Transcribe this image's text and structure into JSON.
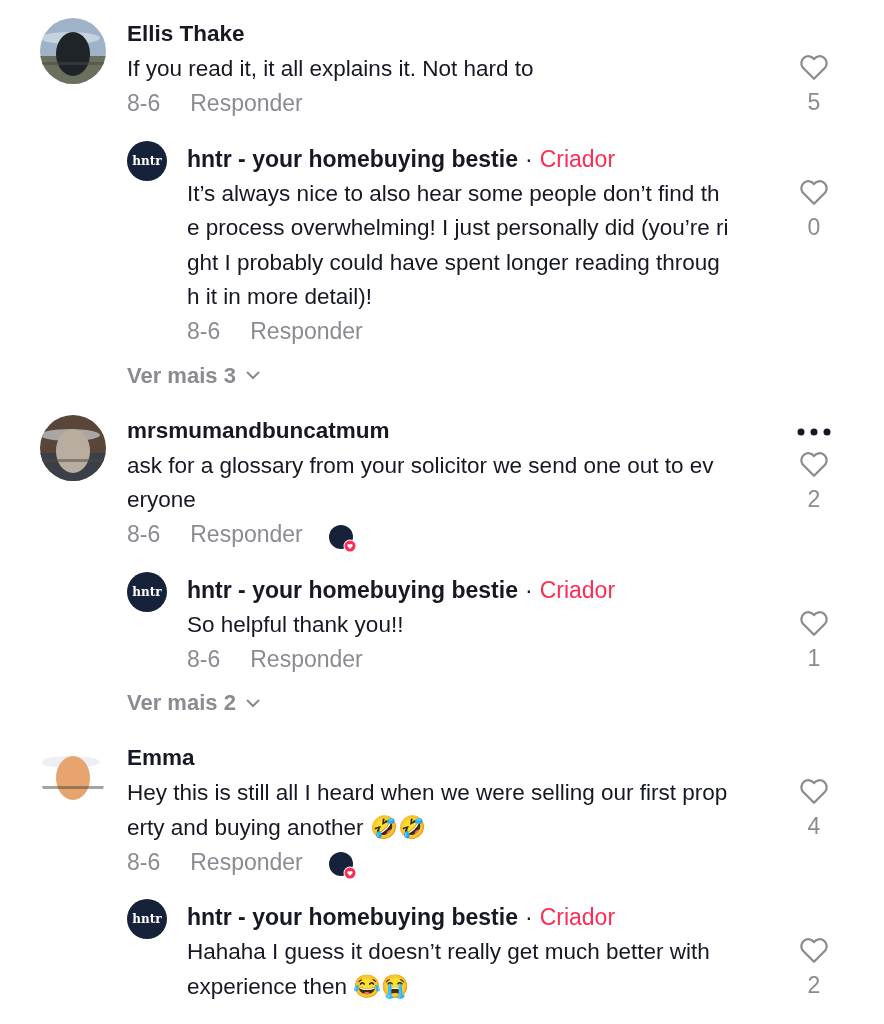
{
  "comments": [
    {
      "name": "Ellis Thake",
      "lines": [
        "If you read it, it all explains it. Not hard to"
      ],
      "date": "8-6",
      "reply_label": "Responder",
      "creator_liked": false,
      "more": false,
      "liked": false,
      "likes": "5",
      "replies": [
        {
          "name": "hntr - your homebuying bestie",
          "avatar_text": "hntr",
          "badge_separator": "·",
          "badge": "Criador",
          "lines": [
            "It’s always nice to also hear some people don’t find th",
            "e process overwhelming! I just personally did (you’re ri",
            "ght I probably could have spent longer reading throug",
            "h it in more detail)!"
          ],
          "date": "8-6",
          "reply_label": "Responder",
          "liked": false,
          "likes": "0"
        }
      ],
      "view_more": "Ver mais 3"
    },
    {
      "name": "mrsmumandbuncatmum",
      "lines": [
        "ask for a glossary from your solicitor we send one out to ev",
        "eryone"
      ],
      "date": "8-6",
      "reply_label": "Responder",
      "creator_liked": true,
      "more": true,
      "liked": false,
      "likes": "2",
      "replies": [
        {
          "name": "hntr - your homebuying bestie",
          "avatar_text": "hntr",
          "badge_separator": "·",
          "badge": "Criador",
          "lines": [
            "So helpful thank you!!"
          ],
          "date": "8-6",
          "reply_label": "Responder",
          "liked": false,
          "likes": "1"
        }
      ],
      "view_more": "Ver mais 2"
    },
    {
      "name": "Emma",
      "lines": [
        "Hey this is still all I heard when we were selling our first prop",
        "erty and buying another 🤣🤣"
      ],
      "date": "8-6",
      "reply_label": "Responder",
      "creator_liked": true,
      "more": false,
      "liked": false,
      "likes": "4",
      "replies": [
        {
          "name": "hntr - your homebuying bestie",
          "avatar_text": "hntr",
          "badge_separator": "·",
          "badge": "Criador",
          "lines": [
            "Hahaha I guess it doesn’t really get much better with",
            "experience then 😂😭"
          ],
          "liked": false,
          "likes": "2"
        }
      ]
    }
  ]
}
